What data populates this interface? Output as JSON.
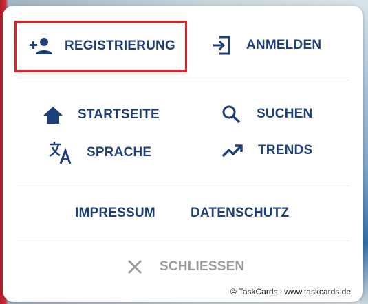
{
  "menu": {
    "register_label": "REGISTRIERUNG",
    "login_label": "ANMELDEN",
    "home_label": "STARTSEITE",
    "search_label": "SUCHEN",
    "language_label": "SPRACHE",
    "trends_label": "TRENDS",
    "imprint_label": "IMPRESSUM",
    "privacy_label": "DATENSCHUTZ",
    "close_label": "SCHLIESSEN"
  },
  "footer": {
    "credit": "© TaskCards | www.taskcards.de"
  },
  "icons": {
    "register": "person-add-icon",
    "login": "login-icon",
    "home": "home-icon",
    "search": "search-icon",
    "language": "translate-icon",
    "trends": "trending-up-icon",
    "close": "close-icon"
  },
  "colors": {
    "primary_text": "#1d3f7a",
    "highlight_border": "#e31e24",
    "muted": "#9a9a9a"
  }
}
